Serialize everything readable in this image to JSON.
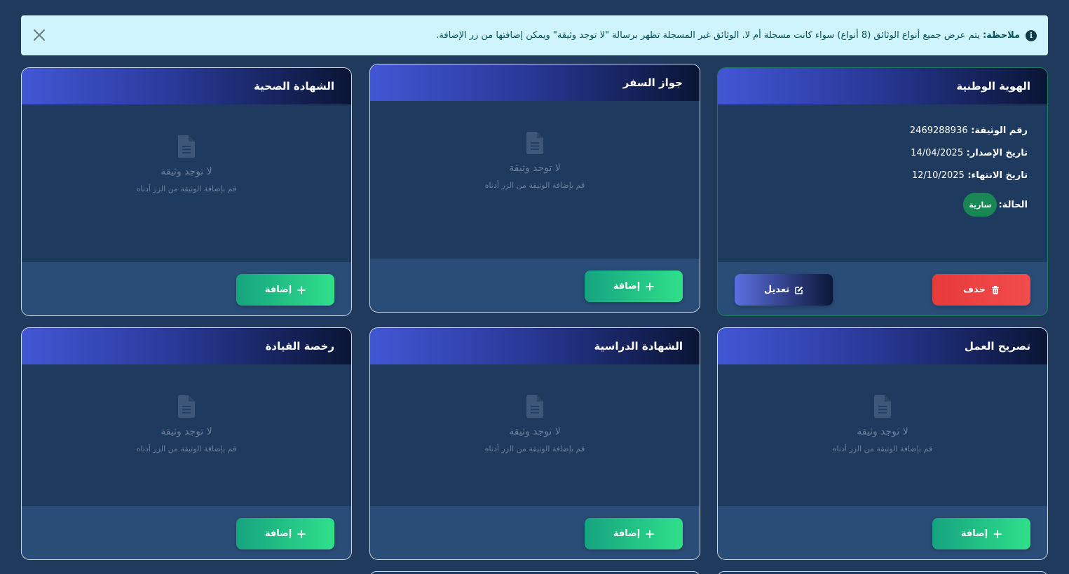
{
  "alert": {
    "label": "ملاحظة:",
    "text": "يتم عرض جميع أنواع الوثائق (8 أنواع) سواء كانت مسجلة أم لا. الوثائق غير المسجلة تظهر برسالة \"لا توجد وثيقة\" ويمكن إضافتها من زر الإضافة."
  },
  "empty_state": {
    "title": "لا توجد وثيقة",
    "hint": "قم بإضافة الوثيقة من الزر أدناه"
  },
  "buttons": {
    "add": "إضافة",
    "edit": "تعديل",
    "delete": "حذف"
  },
  "cards": [
    {
      "title": "الهوية الوطنية",
      "doc_number_label": "رقم الوثيقة:",
      "doc_number": "2469288936",
      "issue_label": "تاريخ الإصدار:",
      "issue_date": "14/04/2025",
      "expiry_label": "تاريخ الانتهاء:",
      "expiry_date": "12/10/2025",
      "status_label": "الحالة:",
      "status": "سارية"
    },
    {
      "title": "جواز السفر"
    },
    {
      "title": "الشهادة الصحية"
    },
    {
      "title": "تصريح العمل"
    },
    {
      "title": "الشهادة الدراسية"
    },
    {
      "title": "رخصة القيادة"
    }
  ],
  "colors": {
    "background": "#203a5e",
    "header_start": "#4257d4",
    "header_end": "#0a1535",
    "add_button": "#2fe08a",
    "delete_button": "#e73a3a",
    "status_badge": "#198754",
    "alert_bg": "#cff4fc"
  },
  "icons": {
    "info": "info-circle-icon",
    "close": "close-icon",
    "document": "file-document-icon",
    "plus": "plus-icon",
    "trash": "trash-icon",
    "edit": "edit-icon"
  }
}
